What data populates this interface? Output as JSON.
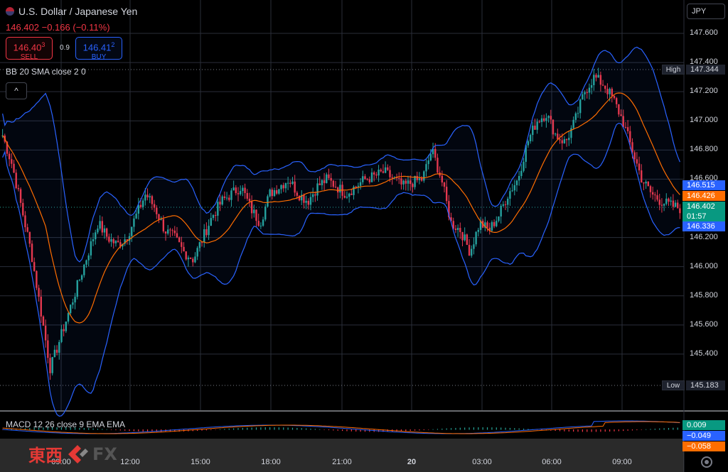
{
  "symbol": {
    "title": "U.S. Dollar / Japanese Yen",
    "price": "146.402",
    "change": "−0.166",
    "change_pct": "(−0.11%)"
  },
  "trade": {
    "sell_price": "146.40",
    "sell_sup": "3",
    "sell_label": "SELL",
    "spread": "0.9",
    "buy_price": "146.41",
    "buy_sup": "2",
    "buy_label": "BUY"
  },
  "indicators": {
    "bb_legend": "BB 20 SMA close 2 0",
    "macd_legend": "MACD 12 26 close 9 EMA EMA",
    "collapse_glyph": "^"
  },
  "currency": "JPY",
  "price_axis": {
    "ticks": [
      "147.600",
      "147.400",
      "147.200",
      "147.000",
      "146.800",
      "146.600",
      "146.200",
      "146.000",
      "145.800",
      "145.600",
      "145.400"
    ],
    "high_label": "High",
    "high_value": "147.344",
    "low_label": "Low",
    "low_value": "145.183",
    "bb_upper": "146.515",
    "bb_basis": "146.426",
    "last_price": "146.402",
    "countdown": "01:57",
    "bb_lower": "146.336",
    "macd_hist": "0.009",
    "macd_line": "−0.049",
    "macd_signal": "−0.058"
  },
  "time_axis": [
    "09:00",
    "12:00",
    "15:00",
    "18:00",
    "21:00",
    "20",
    "03:00",
    "06:00",
    "09:00"
  ],
  "watermark": {
    "jp": "東西",
    "fx": "FX"
  },
  "colors": {
    "up": "#26a69a",
    "down": "#f23645",
    "bb_band": "#2962ff",
    "bb_basis": "#ff6d00",
    "macd": "#2962ff",
    "signal": "#ff6d00",
    "grid": "#2a2e39"
  },
  "chart_data": {
    "type": "candlestick",
    "title": "U.S. Dollar / Japanese Yen",
    "ylim": [
      145.1,
      147.7
    ],
    "close_series": [
      146.9,
      146.7,
      146.4,
      146.1,
      145.7,
      145.3,
      145.5,
      145.7,
      145.9,
      146.1,
      146.3,
      146.2,
      146.15,
      146.2,
      146.35,
      146.5,
      146.4,
      146.25,
      146.2,
      146.1,
      146.05,
      146.2,
      146.35,
      146.45,
      146.5,
      146.55,
      146.4,
      146.3,
      146.5,
      146.55,
      146.6,
      146.5,
      146.45,
      146.55,
      146.6,
      146.55,
      146.5,
      146.55,
      146.6,
      146.62,
      146.65,
      146.6,
      146.55,
      146.58,
      146.6,
      146.8,
      146.6,
      146.3,
      146.25,
      146.1,
      146.3,
      146.25,
      146.35,
      146.5,
      146.6,
      146.85,
      147.0,
      147.05,
      146.9,
      146.85,
      147.0,
      147.2,
      147.3,
      147.25,
      147.15,
      147.0,
      146.8,
      146.6,
      146.5,
      146.45,
      146.42,
      146.4
    ]
  }
}
